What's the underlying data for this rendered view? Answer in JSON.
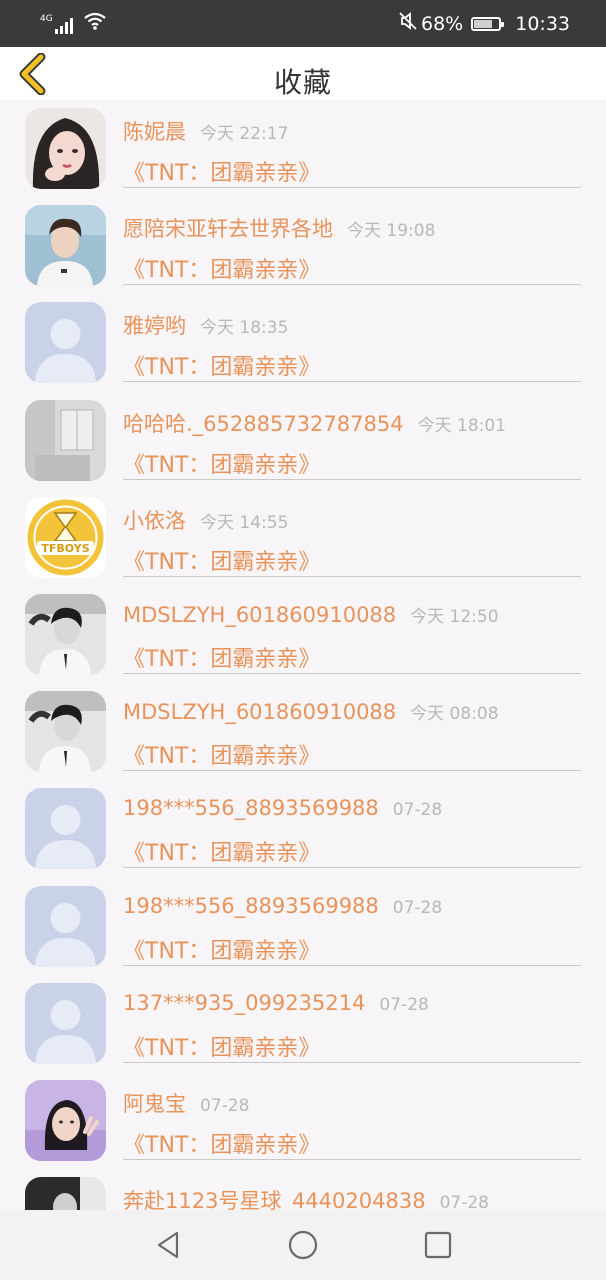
{
  "status_bar": {
    "network_type": "4G",
    "battery_percent": "68%",
    "battery_level": 0.68,
    "time": "10:33",
    "icons": [
      "signal-icon",
      "wifi-icon",
      "mute-icon",
      "battery-icon"
    ]
  },
  "header": {
    "title": "收藏",
    "back_icon": "chevron-left-icon",
    "accent_color": "#f2c224"
  },
  "colors": {
    "name_text": "#e8935a",
    "time_text": "#b8b8b8",
    "background": "#f7f5f7"
  },
  "favorites": [
    {
      "name": "陈妮晨",
      "time": "今天 22:17",
      "title": "《TNT：团霸亲亲》",
      "avatar": "photo-girl-long-hair"
    },
    {
      "name": "愿陪宋亚轩去世界各地",
      "time": "今天 19:08",
      "title": "《TNT：团霸亲亲》",
      "avatar": "photo-boy-white-shirt"
    },
    {
      "name": "雅婷哟",
      "time": "今天 18:35",
      "title": "《TNT：团霸亲亲》",
      "avatar": "default-user"
    },
    {
      "name": "哈哈哈._652885732787854",
      "time": "今天 18:01",
      "title": "《TNT：团霸亲亲》",
      "avatar": "photo-gray-room"
    },
    {
      "name": "小依洛",
      "time": "今天 14:55",
      "title": "《TNT：团霸亲亲》",
      "avatar": "tfboys-badge"
    },
    {
      "name": "MDSLZYH_601860910088",
      "time": "今天 12:50",
      "title": "《TNT：团霸亲亲》",
      "avatar": "photo-boy-bw"
    },
    {
      "name": "MDSLZYH_601860910088",
      "time": "今天 08:08",
      "title": "《TNT：团霸亲亲》",
      "avatar": "photo-boy-bw"
    },
    {
      "name": "198***556_8893569988",
      "time": "07-28",
      "title": "《TNT：团霸亲亲》",
      "avatar": "default-user"
    },
    {
      "name": "198***556_8893569988",
      "time": "07-28",
      "title": "《TNT：团霸亲亲》",
      "avatar": "default-user"
    },
    {
      "name": "137***935_099235214",
      "time": "07-28",
      "title": "《TNT：团霸亲亲》",
      "avatar": "default-user"
    },
    {
      "name": "阿鬼宝",
      "time": "07-28",
      "title": "《TNT：团霸亲亲》",
      "avatar": "photo-girl-purple"
    },
    {
      "name": "奔赴1123号星球_4440204838",
      "time": "07-28",
      "title": "",
      "avatar": "photo-dark-partial"
    }
  ],
  "nav_bar": {
    "buttons": [
      "back-triangle-icon",
      "home-circle-icon",
      "recents-square-icon"
    ]
  }
}
